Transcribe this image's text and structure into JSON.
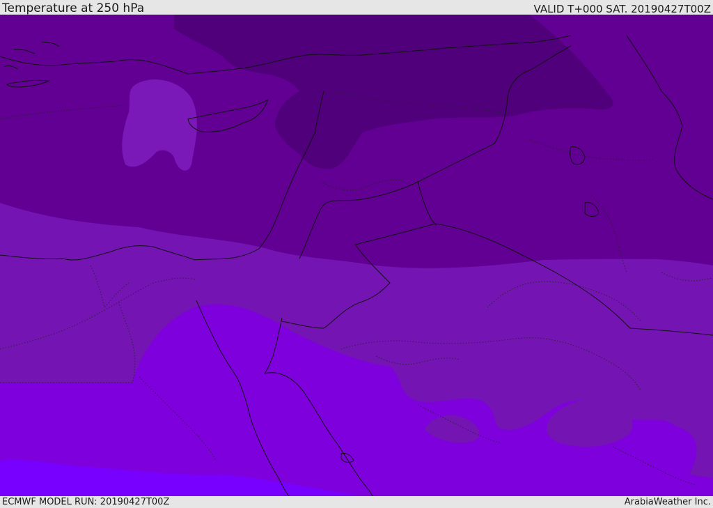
{
  "header": {
    "title": "Temperature at 250 hPa",
    "valid": "VALID T+000 SAT. 20190427T00Z"
  },
  "footer": {
    "model_run": "ECMWF MODEL RUN: 20190427T00Z",
    "credit": "ArabiaWeather Inc."
  },
  "map": {
    "variable": "temperature-250hpa",
    "colors": {
      "darkest_band": "#4f007a",
      "dark_band": "#610093",
      "mid_band": "#6c00a6",
      "light_band": "#7414b2",
      "violet_band": "#7e00dc",
      "bright_band": "#7800ff",
      "warm_patch": "#7a18b8",
      "border": "#111111"
    }
  }
}
